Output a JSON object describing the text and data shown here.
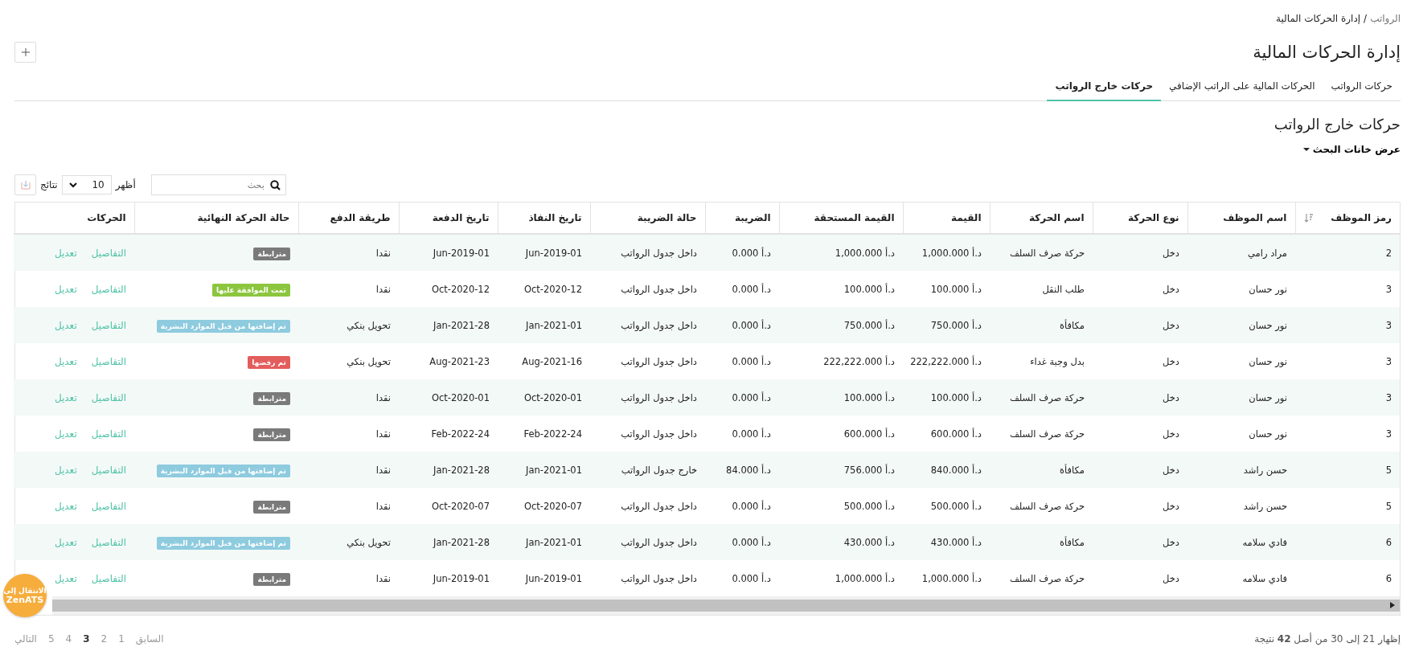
{
  "breadcrumb": {
    "parent": "الرواتب",
    "separator": "/",
    "current": "إدارة الحركات المالية"
  },
  "title": "إدارة الحركات المالية",
  "tabs": [
    {
      "label": "حركات الرواتب",
      "selected": false
    },
    {
      "label": "الحركات المالية على الراتب الإضافي",
      "selected": false
    },
    {
      "label": "حركات خارج الرواتب",
      "selected": true
    }
  ],
  "section_title": "حركات خارج الرواتب",
  "search_toggle": {
    "label": "عرض خانات البحث",
    "expanded": false
  },
  "toolbar": {
    "search_placeholder": "بحث",
    "show_label": "أظهر",
    "page_size": "10",
    "results_label": "نتائج"
  },
  "table": {
    "columns": [
      "رمز الموظف",
      "اسم الموظف",
      "نوع الحركة",
      "اسم الحركة",
      "القيمة",
      "القيمة المستحقة",
      "الضريبة",
      "حالة الضريبة",
      "تاريخ النفاذ",
      "تاريخ الدفعة",
      "طريقة الدفع",
      "حالة الحركة النهائية",
      "الحركات"
    ],
    "rows": [
      {
        "cells": [
          "2",
          "مراد رامي",
          "دخل",
          "حركة صرف السلف",
          "د.أ 1,000.000",
          "د.أ 1,000.000",
          "د.أ 0.000",
          "داخل جدول الرواتب",
          "Jun-2019-01",
          "Jun-2019-01",
          "نقدا"
        ],
        "status": {
          "label": "مترابطة",
          "color": "#7a7a7a"
        },
        "actions": [
          "التفاصيل",
          "تعديل"
        ]
      },
      {
        "cells": [
          "3",
          "نور حسان",
          "دخل",
          "طلب النقل",
          "د.أ 100.000",
          "د.أ 100.000",
          "د.أ 0.000",
          "داخل جدول الرواتب",
          "Oct-2020-12",
          "Oct-2020-12",
          "نقدا"
        ],
        "status": {
          "label": "تمت الموافقة عليها",
          "color": "#8cc63f"
        },
        "actions": [
          "التفاصيل",
          "تعديل"
        ]
      },
      {
        "cells": [
          "3",
          "نور حسان",
          "دخل",
          "مكافأة",
          "د.أ 750.000",
          "د.أ 750.000",
          "د.أ 0.000",
          "داخل جدول الرواتب",
          "Jan-2021-01",
          "Jan-2021-28",
          "تحويل بنكي"
        ],
        "status": {
          "label": "تم إضافتها من قبل الموارد البشرية",
          "color": "#8ecbdf"
        },
        "actions": [
          "التفاصيل",
          "تعديل"
        ]
      },
      {
        "cells": [
          "3",
          "نور حسان",
          "دخل",
          "بدل وجبة غداء",
          "د.أ 222,222.000",
          "د.أ 222,222.000",
          "د.أ 0.000",
          "داخل جدول الرواتب",
          "Aug-2021-16",
          "Aug-2021-23",
          "تحويل بنكي"
        ],
        "status": {
          "label": "تم رفضها",
          "color": "#e35d5d"
        },
        "actions": [
          "التفاصيل",
          "تعديل"
        ]
      },
      {
        "cells": [
          "3",
          "نور حسان",
          "دخل",
          "حركة صرف السلف",
          "د.أ 100.000",
          "د.أ 100.000",
          "د.أ 0.000",
          "داخل جدول الرواتب",
          "Oct-2020-01",
          "Oct-2020-01",
          "نقدا"
        ],
        "status": {
          "label": "مترابطة",
          "color": "#7a7a7a"
        },
        "actions": [
          "التفاصيل",
          "تعديل"
        ]
      },
      {
        "cells": [
          "3",
          "نور حسان",
          "دخل",
          "حركة صرف السلف",
          "د.أ 600.000",
          "د.أ 600.000",
          "د.أ 0.000",
          "داخل جدول الرواتب",
          "Feb-2022-24",
          "Feb-2022-24",
          "نقدا"
        ],
        "status": {
          "label": "مترابطة",
          "color": "#7a7a7a"
        },
        "actions": [
          "التفاصيل",
          "تعديل"
        ]
      },
      {
        "cells": [
          "5",
          "حسن راشد",
          "دخل",
          "مكافأة",
          "د.أ 840.000",
          "د.أ 756.000",
          "د.أ 84.000",
          "خارج جدول الرواتب",
          "Jan-2021-01",
          "Jan-2021-28",
          "نقدا"
        ],
        "status": {
          "label": "تم إضافتها من قبل الموارد البشرية",
          "color": "#8ecbdf"
        },
        "actions": [
          "التفاصيل",
          "تعديل"
        ]
      },
      {
        "cells": [
          "5",
          "حسن راشد",
          "دخل",
          "حركة صرف السلف",
          "د.أ 500.000",
          "د.أ 500.000",
          "د.أ 0.000",
          "داخل جدول الرواتب",
          "Oct-2020-07",
          "Oct-2020-07",
          "نقدا"
        ],
        "status": {
          "label": "مترابطة",
          "color": "#7a7a7a"
        },
        "actions": [
          "التفاصيل",
          "تعديل"
        ]
      },
      {
        "cells": [
          "6",
          "فادي سلامه",
          "دخل",
          "مكافأة",
          "د.أ 430.000",
          "د.أ 430.000",
          "د.أ 0.000",
          "داخل جدول الرواتب",
          "Jan-2021-01",
          "Jan-2021-28",
          "تحويل بنكي"
        ],
        "status": {
          "label": "تم إضافتها من قبل الموارد البشرية",
          "color": "#8ecbdf"
        },
        "actions": [
          "التفاصيل",
          "تعديل"
        ]
      },
      {
        "cells": [
          "6",
          "فادي سلامه",
          "دخل",
          "حركة صرف السلف",
          "د.أ 1,000.000",
          "د.أ 1,000.000",
          "د.أ 0.000",
          "داخل جدول الرواتب",
          "Jun-2019-01",
          "Jun-2019-01",
          "نقدا"
        ],
        "status": {
          "label": "مترابطة",
          "color": "#7a7a7a"
        },
        "actions": [
          "التفاصيل",
          "تعديل"
        ]
      }
    ]
  },
  "summary": "إظهار 21 إلى 30 من أصل **42** نتيجة",
  "pagination": [
    {
      "label": "السابق",
      "selected": false
    },
    {
      "label": "1",
      "selected": false
    },
    {
      "label": "2",
      "selected": false
    },
    {
      "label": "3",
      "selected": true
    },
    {
      "label": "4",
      "selected": false
    },
    {
      "label": "5",
      "selected": false
    },
    {
      "label": "التالي",
      "selected": false
    }
  ],
  "floating_button": {
    "line1": "الانتقال إلى",
    "line2": "ZenATS"
  }
}
